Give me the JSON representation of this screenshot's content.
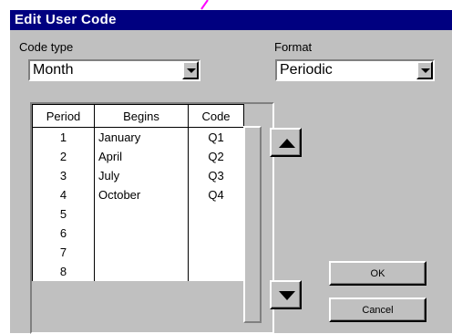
{
  "dialog": {
    "title": "Edit User Code",
    "code_type_label": "Code type",
    "code_type_value": "Month",
    "format_label": "Format",
    "format_value": "Periodic"
  },
  "table": {
    "headers": [
      "Period",
      "Begins",
      "Code"
    ],
    "rows": [
      {
        "period": "1",
        "begins": "January",
        "code": "Q1"
      },
      {
        "period": "2",
        "begins": "April",
        "code": "Q2"
      },
      {
        "period": "3",
        "begins": "July",
        "code": "Q3"
      },
      {
        "period": "4",
        "begins": "October",
        "code": "Q4"
      },
      {
        "period": "5",
        "begins": "",
        "code": ""
      },
      {
        "period": "6",
        "begins": "",
        "code": ""
      },
      {
        "period": "7",
        "begins": "",
        "code": ""
      },
      {
        "period": "8",
        "begins": "",
        "code": ""
      }
    ]
  },
  "buttons": {
    "up_icon": "triangle-up-icon",
    "down_icon": "triangle-down-icon",
    "ok_label": "OK",
    "cancel_label": "Cancel"
  },
  "colors": {
    "title_bar": "#000080",
    "face": "#c0c0c0",
    "pink_mark": "#ff00ff"
  }
}
